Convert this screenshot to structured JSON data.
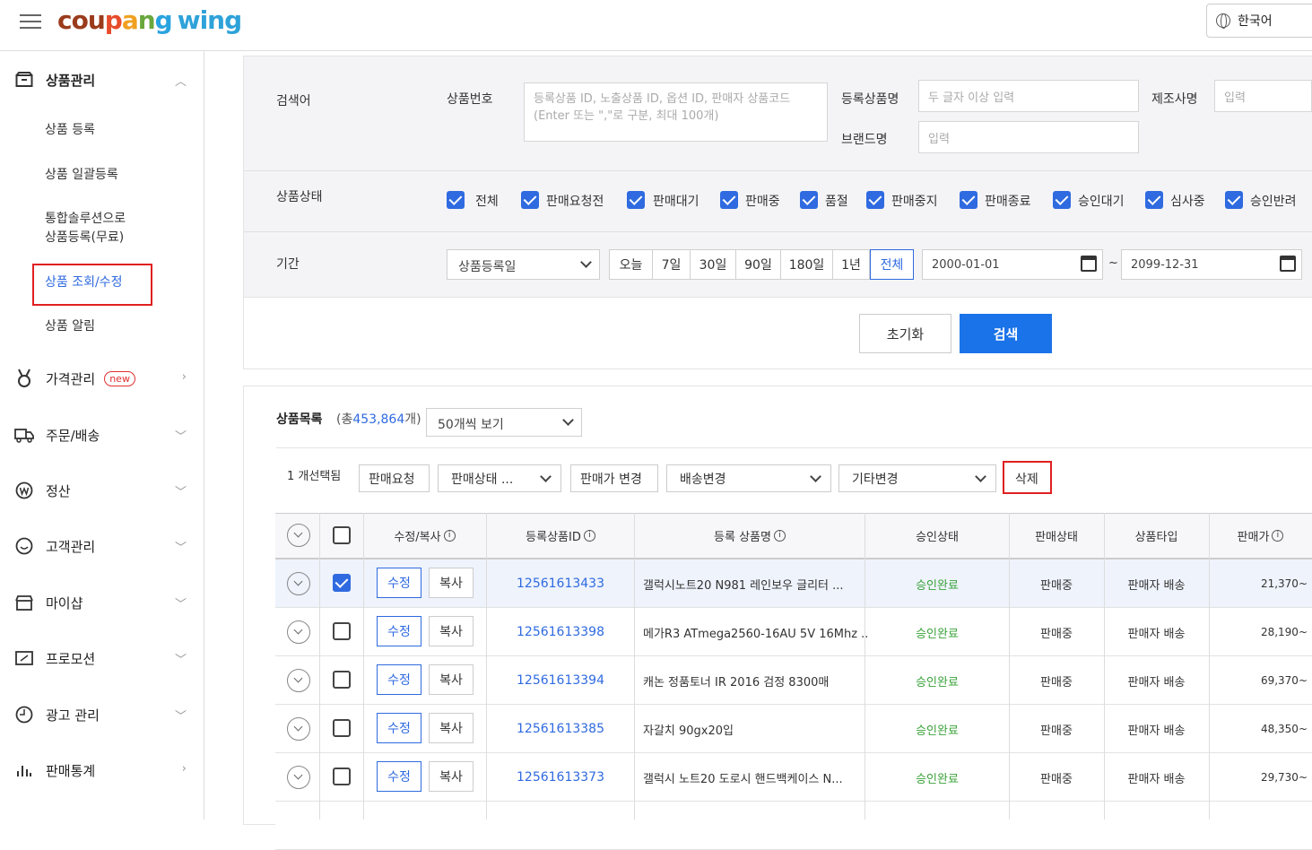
{
  "header": {
    "logo": {
      "c1": "cou",
      "c2": "p",
      "c3": "a",
      "c4": "n",
      "c5": "g",
      "wing": "wing"
    },
    "language": "한국어"
  },
  "sidebar": {
    "product_mgmt": "상품관리",
    "sub_register": "상품 등록",
    "sub_bulk": "상품 일괄등록",
    "sub_solution_1": "통합솔루션으로",
    "sub_solution_2": "상품등록(무료)",
    "sub_search_edit": "상품 조회/수정",
    "sub_alert": "상품 알림",
    "price_mgmt": "가격관리",
    "price_new": "new",
    "order": "주문/배송",
    "settlement": "정산",
    "customer": "고객관리",
    "myshop": "마이샵",
    "promotion": "프로모션",
    "ad": "광고 관리",
    "stats": "판매통계"
  },
  "search": {
    "keyword_label": "검색어",
    "product_no_label": "상품번호",
    "product_no_placeholder": "등록상품 ID, 노출상품 ID, 옵션 ID, 판매자 상품코드(Enter 또는 \",\"로 구분, 최대 100개)",
    "reg_name_label": "등록상품명",
    "reg_name_placeholder": "두 글자 이상 입력",
    "maker_label": "제조사명",
    "maker_placeholder": "입력",
    "brand_label": "브랜드명",
    "brand_placeholder": "입력",
    "status_label": "상품상태",
    "statuses": [
      "전체",
      "판매요청전",
      "판매대기",
      "판매중",
      "품절",
      "판매중지",
      "판매종료",
      "승인대기",
      "심사중",
      "승인반려"
    ],
    "period_label": "기간",
    "period_type": "상품등록일",
    "period_buttons": [
      "오늘",
      "7일",
      "30일",
      "90일",
      "180일",
      "1년",
      "전체"
    ],
    "date_from": "2000-01-01",
    "date_to": "2099-12-31",
    "tilde": "~",
    "reset": "초기화",
    "submit": "검색"
  },
  "list": {
    "title": "상품목록",
    "count_prefix": "(총",
    "count": "453,864",
    "count_suffix": "개)",
    "page_size": "50개씩 보기",
    "selected_text": "1 개선택됨",
    "actions": {
      "sale_request": "판매요청",
      "sale_status": "판매상태 ...",
      "price_change": "판매가 변경",
      "shipping_change": "배송변경",
      "other_change": "기타변경",
      "delete": "삭제"
    },
    "columns": {
      "edit_copy": "수정/복사",
      "product_id": "등록상품ID",
      "product_name": "등록 상품명",
      "approval": "승인상태",
      "sale_status": "판매상태",
      "product_type": "상품타입",
      "price": "판매가"
    },
    "info_glyph": "i",
    "edit_label": "수정",
    "copy_label": "복사",
    "rows": [
      {
        "id": "12561613433",
        "name": "갤럭시노트20 N981 레인보우 글리터 ...",
        "approval": "승인완료",
        "status": "판매중",
        "type": "판매자 배송",
        "price": "21,370~",
        "checked": true
      },
      {
        "id": "12561613398",
        "name": "메가R3 ATmega2560-16AU 5V 16Mhz ...",
        "approval": "승인완료",
        "status": "판매중",
        "type": "판매자 배송",
        "price": "28,190~",
        "checked": false
      },
      {
        "id": "12561613394",
        "name": "캐논 정품토너 IR 2016 검정 8300매",
        "approval": "승인완료",
        "status": "판매중",
        "type": "판매자 배송",
        "price": "69,370~",
        "checked": false
      },
      {
        "id": "12561613385",
        "name": "자갈치 90gx20입",
        "approval": "승인완료",
        "status": "판매중",
        "type": "판매자 배송",
        "price": "48,350~",
        "checked": false
      },
      {
        "id": "12561613373",
        "name": "갤럭시 노트20 도로시 핸드백케이스 N...",
        "approval": "승인완료",
        "status": "판매중",
        "type": "판매자 배송",
        "price": "29,730~",
        "checked": false
      }
    ]
  },
  "colors": {
    "accent": "#2f6ae0",
    "primary_button": "#1a73e8",
    "approved": "#3aa23a",
    "highlight": "#e02020"
  }
}
